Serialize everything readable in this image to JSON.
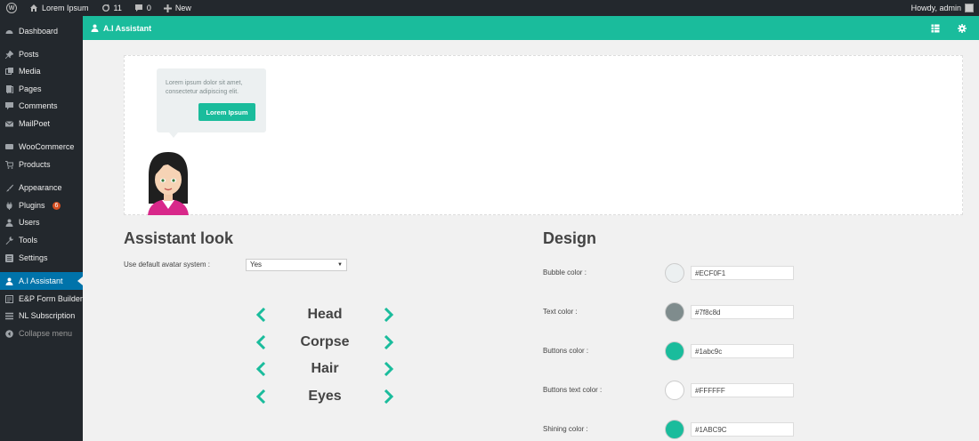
{
  "adminbar": {
    "site_name": "Lorem Ipsum",
    "updates_count": "11",
    "comments_count": "0",
    "new_label": "New",
    "howdy": "Howdy, admin"
  },
  "sidebar": {
    "items": [
      {
        "label": "Dashboard",
        "icon": "dashboard-icon"
      },
      {
        "label": "Posts",
        "icon": "pin-icon"
      },
      {
        "label": "Media",
        "icon": "media-icon"
      },
      {
        "label": "Pages",
        "icon": "pages-icon"
      },
      {
        "label": "Comments",
        "icon": "comment-icon"
      },
      {
        "label": "MailPoet",
        "icon": "mail-icon"
      },
      {
        "label": "WooCommerce",
        "icon": "woo-icon"
      },
      {
        "label": "Products",
        "icon": "cart-icon"
      },
      {
        "label": "Appearance",
        "icon": "brush-icon"
      },
      {
        "label": "Plugins",
        "icon": "plug-icon",
        "badge": "6"
      },
      {
        "label": "Users",
        "icon": "user-icon"
      },
      {
        "label": "Tools",
        "icon": "wrench-icon"
      },
      {
        "label": "Settings",
        "icon": "settings-icon"
      },
      {
        "label": "A.I Assistant",
        "icon": "person-icon",
        "active": true
      },
      {
        "label": "E&P Form Builder",
        "icon": "form-icon"
      },
      {
        "label": "NL Subscription",
        "icon": "list-icon"
      },
      {
        "label": "Collapse menu",
        "icon": "collapse-icon"
      }
    ]
  },
  "header": {
    "title": "A.I Assistant"
  },
  "preview": {
    "bubble_text": "Lorem ipsum dolor sit amet, consectetur adipiscing elit.",
    "bubble_button": "Lorem Ipsum"
  },
  "look": {
    "title": "Assistant look",
    "default_avatar_label": "Use default avatar system :",
    "default_avatar_value": "Yes",
    "parts": [
      "Head",
      "Corpse",
      "Hair",
      "Eyes"
    ]
  },
  "design": {
    "title": "Design",
    "rows": [
      {
        "label": "Bubble color :",
        "value": "#ECF0F1",
        "color": "#ecf0f1"
      },
      {
        "label": "Text color :",
        "value": "#7f8c8d",
        "color": "#7f8c8d"
      },
      {
        "label": "Buttons color :",
        "value": "#1abc9c",
        "color": "#1abc9c"
      },
      {
        "label": "Buttons text color :",
        "value": "#FFFFFF",
        "color": "#ffffff"
      },
      {
        "label": "Shining color :",
        "value": "#1ABC9C",
        "color": "#1abc9c"
      }
    ]
  },
  "colors": {
    "accent": "#1abc9c",
    "admin_dark": "#23282d",
    "active_menu": "#0073aa"
  }
}
